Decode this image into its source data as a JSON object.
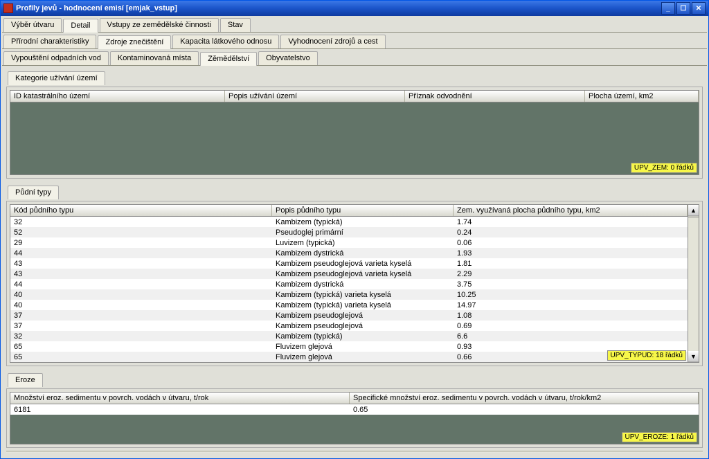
{
  "window": {
    "title": "Profily jevů - hodnocení emisí [emjak_vstup]"
  },
  "tabs_main": [
    {
      "label": "Výběr útvaru"
    },
    {
      "label": "Detail"
    },
    {
      "label": "Vstupy ze zemědělské činnosti"
    },
    {
      "label": "Stav"
    }
  ],
  "tabs_main_active": 1,
  "tabs_sub": [
    {
      "label": "Přírodní charakteristiky"
    },
    {
      "label": "Zdroje znečištění"
    },
    {
      "label": "Kapacita látkového odnosu"
    },
    {
      "label": "Vyhodnocení zdrojů a cest"
    }
  ],
  "tabs_sub_active": 1,
  "tabs_sub2": [
    {
      "label": "Vypouštění odpadních vod"
    },
    {
      "label": "Kontaminovaná místa"
    },
    {
      "label": "Zěmědělství"
    },
    {
      "label": "Obyvatelstvo"
    }
  ],
  "tabs_sub2_active": 2,
  "kategorie": {
    "group_label": "Kategorie užívání území",
    "headers": [
      "ID katastrálního území",
      "Popis užívání území",
      "Příznak odvodnění",
      "Plocha území, km2"
    ],
    "status": "UPV_ZEM: 0 řádků"
  },
  "pudni": {
    "group_label": "Půdní typy",
    "headers": [
      "Kód půdního typu",
      "Popis půdního typu",
      "Zem. využívaná plocha půdního typu, km2"
    ],
    "rows": [
      [
        "32",
        "Kambizem (typická)",
        "1.74"
      ],
      [
        "52",
        "Pseudoglej primární",
        "0.24"
      ],
      [
        "29",
        "Luvizem (typická)",
        "0.06"
      ],
      [
        "44",
        "Kambizem dystrická",
        "1.93"
      ],
      [
        "43",
        "Kambizem pseudoglejová varieta kyselá",
        "1.81"
      ],
      [
        "43",
        "Kambizem pseudoglejová varieta kyselá",
        "2.29"
      ],
      [
        "44",
        "Kambizem dystrická",
        "3.75"
      ],
      [
        "40",
        "Kambizem (typická) varieta kyselá",
        "10.25"
      ],
      [
        "40",
        "Kambizem (typická) varieta kyselá",
        "14.97"
      ],
      [
        "37",
        "Kambizem pseudoglejová",
        "1.08"
      ],
      [
        "37",
        "Kambizem pseudoglejová",
        "0.69"
      ],
      [
        "32",
        "Kambizem (typická)",
        "6.6"
      ],
      [
        "65",
        "Fluvizem glejová",
        "0.93"
      ],
      [
        "65",
        "Fluvizem glejová",
        "0.66"
      ]
    ],
    "status": "UPV_TYPUD: 18 řádků"
  },
  "eroze": {
    "group_label": "Eroze",
    "headers": [
      "Množství eroz. sedimentu v povrch. vodách v útvaru, t/rok",
      "Specifické množství eroz. sedimentu v povrch. vodách v útvaru, t/rok/km2"
    ],
    "rows": [
      [
        "6181",
        "0.65"
      ]
    ],
    "status": "UPV_EROZE: 1 řádků"
  }
}
